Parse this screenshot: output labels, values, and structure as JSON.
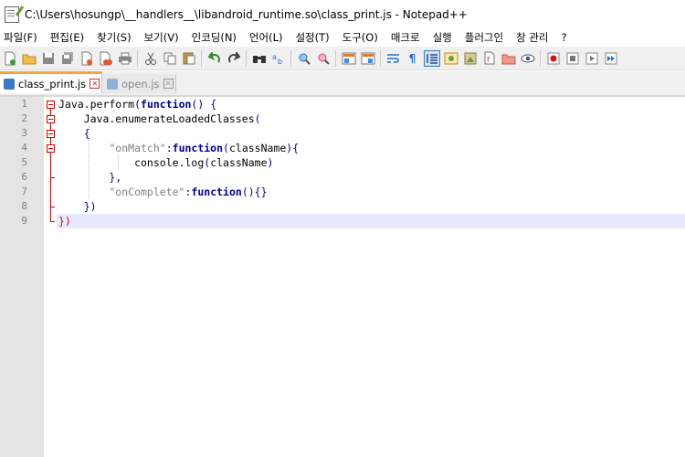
{
  "window": {
    "title": "C:\\Users\\hosungp\\__handlers__\\libandroid_runtime.so\\class_print.js - Notepad++"
  },
  "menu": [
    "파일(F)",
    "편집(E)",
    "찾기(S)",
    "보기(V)",
    "인코딩(N)",
    "언어(L)",
    "설정(T)",
    "도구(O)",
    "매크로",
    "실행",
    "플러그인",
    "창 관리",
    "?"
  ],
  "toolbar": {
    "icons": [
      "new-file-icon",
      "open-file-icon",
      "save-icon",
      "save-all-icon",
      "close-icon",
      "close-all-icon",
      "print-icon",
      "cut-icon",
      "copy-icon",
      "paste-icon",
      "undo-icon",
      "redo-icon",
      "find-icon",
      "replace-icon",
      "zoom-in-icon",
      "zoom-out-icon",
      "sync-vertical-icon",
      "sync-horizontal-icon",
      "word-wrap-icon",
      "show-all-characters-icon",
      "indent-guide-icon",
      "user-defined-language-icon",
      "document-map-icon",
      "function-list-icon",
      "folder-as-workspace-icon",
      "monitoring-icon",
      "record-macro-icon",
      "stop-recording-icon",
      "play-macro-icon",
      "run-macro-multiple-icon"
    ]
  },
  "tabs": [
    {
      "label": "class_print.js",
      "active": true
    },
    {
      "label": "open.js",
      "active": false
    }
  ],
  "editor": {
    "line_numbers": [
      "1",
      "2",
      "3",
      "4",
      "5",
      "6",
      "7",
      "8",
      "9"
    ],
    "lines": [
      "Java.perform(function() {",
      "    Java.enumerateLoadedClasses(",
      "    {",
      "        \"onMatch\":function(className){",
      "            console.log(className)",
      "        },",
      "        \"onComplete\":function(){}",
      "    })",
      "})"
    ],
    "current_line": 9
  },
  "colors": {
    "keyword": "#00008b",
    "string": "#808080",
    "fold_marker": "#cc0000",
    "active_tab_accent": "#f6a43c",
    "current_line_bg": "#e8e8ff"
  }
}
